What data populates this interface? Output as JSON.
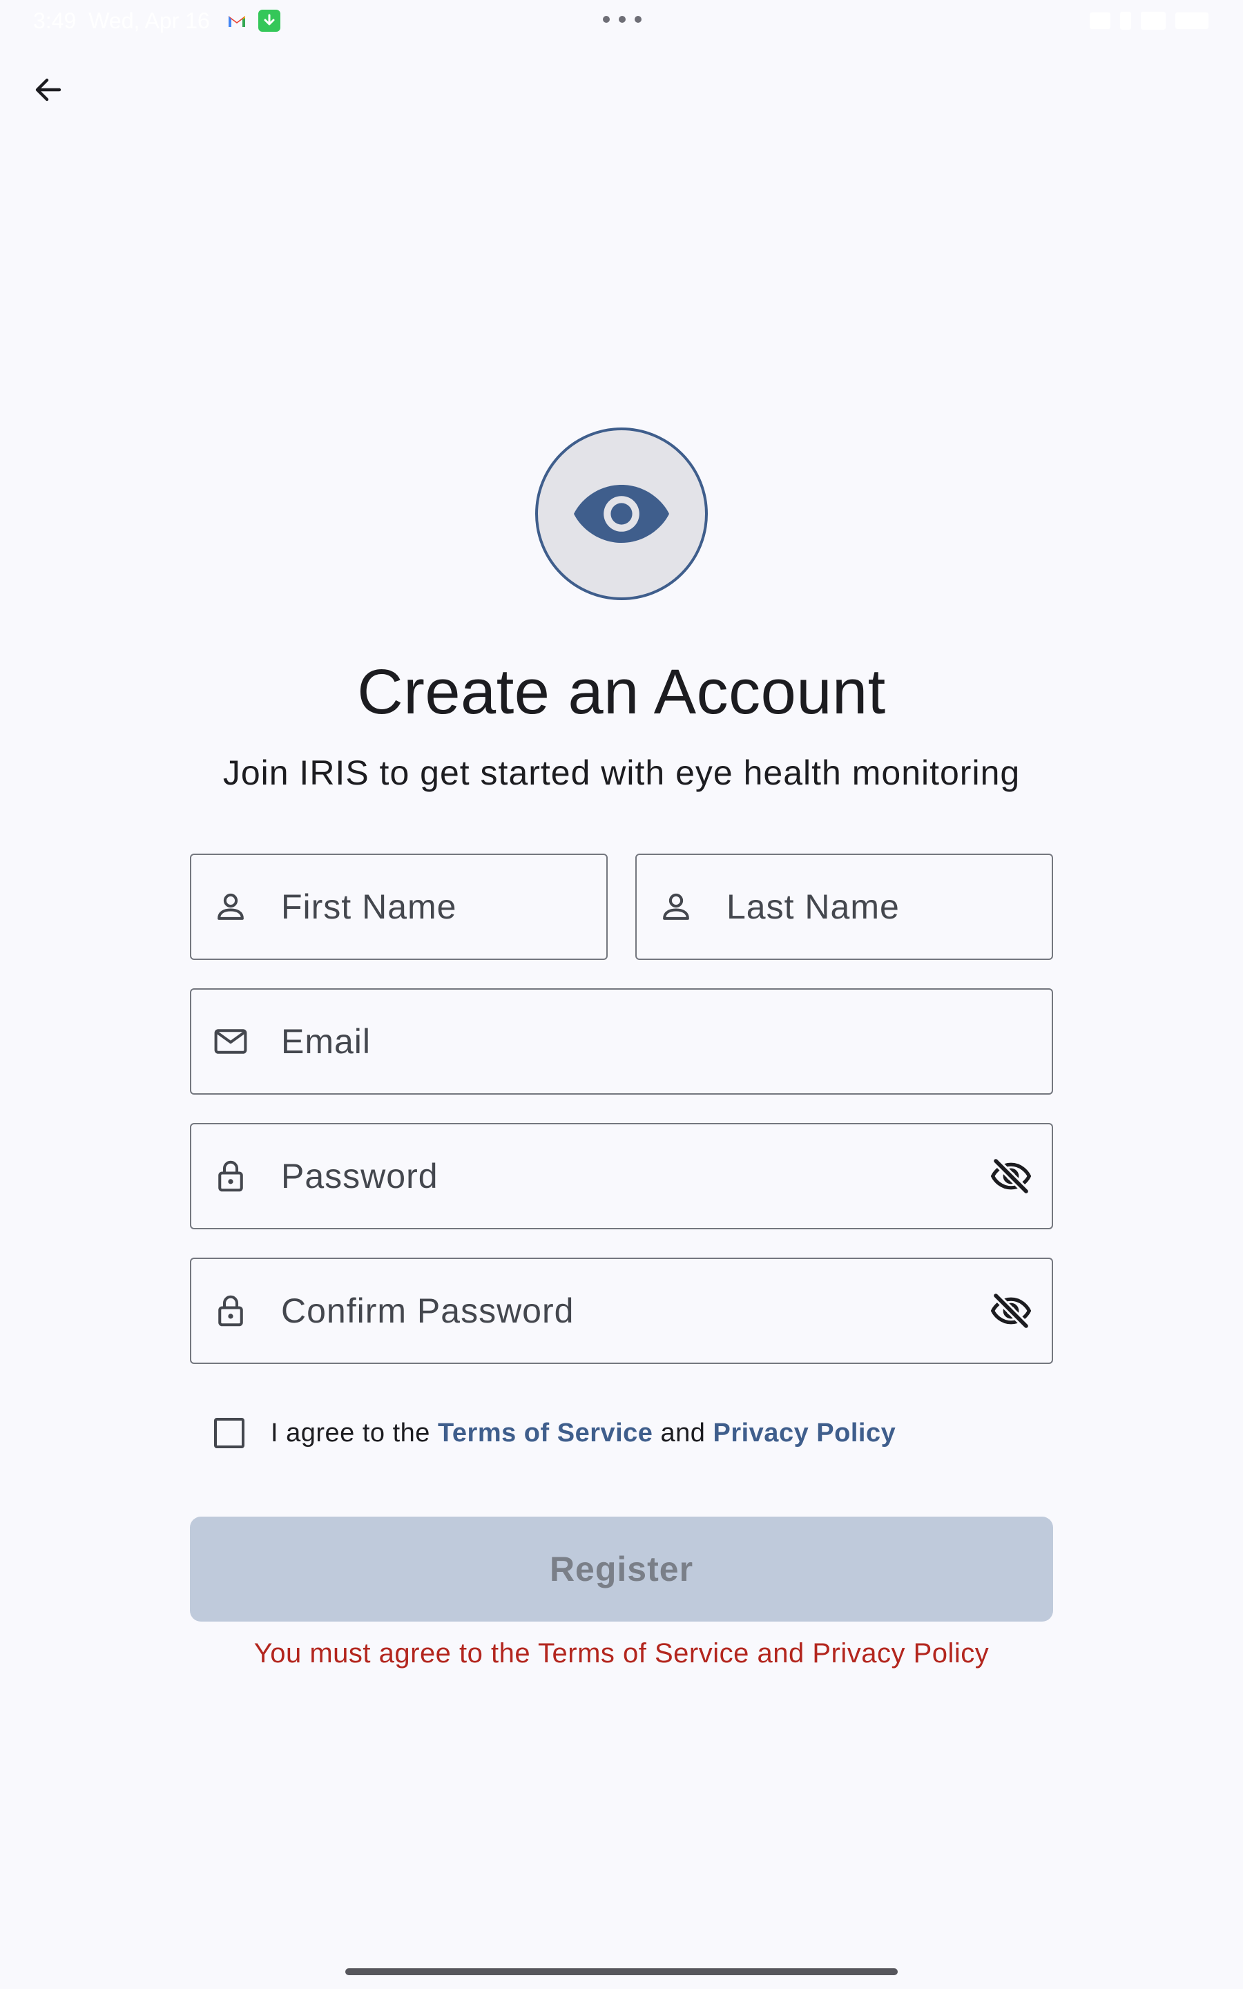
{
  "status_bar": {
    "time": "3:49",
    "date": "Wed, Apr 16"
  },
  "header": {
    "back_icon": "arrow-left-icon"
  },
  "logo": {
    "icon": "eye-icon",
    "accent_color": "#3f5e8c"
  },
  "title": "Create an Account",
  "subtitle": "Join IRIS to get started with eye health monitoring",
  "form": {
    "first_name": {
      "placeholder": "First Name",
      "icon": "person-icon"
    },
    "last_name": {
      "placeholder": "Last Name",
      "icon": "person-icon"
    },
    "email": {
      "placeholder": "Email",
      "icon": "mail-icon"
    },
    "password": {
      "placeholder": "Password",
      "icon": "lock-icon",
      "toggle_icon": "visibility-off-icon"
    },
    "confirm_password": {
      "placeholder": "Confirm Password",
      "icon": "lock-icon",
      "toggle_icon": "visibility-off-icon"
    }
  },
  "terms": {
    "checked": false,
    "prefix": "I agree to the ",
    "terms_link": "Terms of Service",
    "conjunction": " and ",
    "privacy_link": "Privacy Policy"
  },
  "register_button": {
    "label": "Register",
    "disabled": true
  },
  "error_message": "You must agree to the Terms of Service and Privacy Policy",
  "colors": {
    "primary": "#3f5e8c",
    "error": "#b3261e",
    "disabled_button": "#bfcadb",
    "background": "#f9f9fd"
  }
}
